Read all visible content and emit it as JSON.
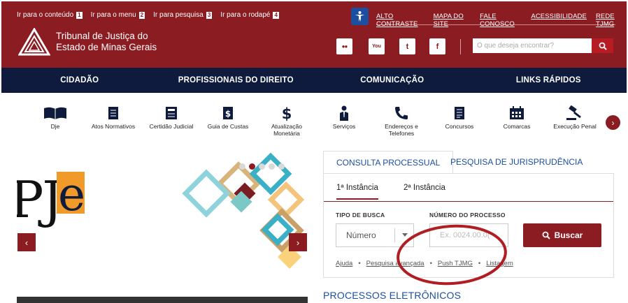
{
  "skip_links": [
    {
      "label": "Ir para o conteúdo",
      "num": "1"
    },
    {
      "label": "Ir para o menu",
      "num": "2"
    },
    {
      "label": "Ir para pesquisa",
      "num": "3"
    },
    {
      "label": "Ir para o rodapé",
      "num": "4"
    }
  ],
  "top_links": [
    "ALTO CONTRASTE",
    "MAPA DO SITE",
    "FALE CONOSCO",
    "ACESSIBILIDADE",
    "REDE TJMG"
  ],
  "logo": {
    "line1": "Tribunal de Justiça do",
    "line2": "Estado de Minas Gerais"
  },
  "social": [
    {
      "icon": "flickr-icon",
      "glyph": "●●"
    },
    {
      "icon": "youtube-icon",
      "glyph": "You"
    },
    {
      "icon": "twitter-icon",
      "glyph": "t"
    },
    {
      "icon": "facebook-icon",
      "glyph": "f"
    }
  ],
  "search": {
    "placeholder": "O que deseja encontrar?"
  },
  "main_nav": [
    "CIDADÃO",
    "PROFISSIONAIS DO DIREITO",
    "COMUNICAÇÃO",
    "LINKS RÁPIDOS"
  ],
  "services": [
    {
      "label": "Dje",
      "icon": "book-icon"
    },
    {
      "label": "Atos Normativos",
      "icon": "document-icon"
    },
    {
      "label": "Certidão Judicial",
      "icon": "certificate-icon"
    },
    {
      "label": "Guia de Custas",
      "icon": "dollar-document-icon"
    },
    {
      "label": "Atualização Monetária",
      "icon": "dollar-icon"
    },
    {
      "label": "Serviços",
      "icon": "person-icon"
    },
    {
      "label": "Endereços e Telefones",
      "icon": "phone-icon"
    },
    {
      "label": "Concursos",
      "icon": "list-document-icon"
    },
    {
      "label": "Comarcas",
      "icon": "calendar-icon"
    },
    {
      "label": "Execução Penal",
      "icon": "gavel-icon"
    }
  ],
  "banner": {
    "text": "PJe",
    "text_left": "PJ",
    "text_right": "e"
  },
  "tabs": [
    "CONSULTA PROCESSUAL",
    "PESQUISA DE JURISPRUDÊNCIA"
  ],
  "subtabs": [
    "1ª Instância",
    "2ª Instância"
  ],
  "form": {
    "tipo_label": "TIPO DE BUSCA",
    "tipo_value": "Número",
    "numero_label": "NÚMERO DO PROCESSO",
    "numero_placeholder": "Ex. 0024.00.0(",
    "buscar": "Buscar"
  },
  "help_links": [
    "Ajuda",
    "Pesquisa avançada",
    "Push TJMG",
    "Listagem"
  ],
  "section_title": "PROCESSOS ELETRÔNICOS",
  "colors": {
    "brand": "#8a1c22",
    "nav": "#0f1b3d",
    "link": "#1c4fa0",
    "annotation": "#b01e24"
  }
}
